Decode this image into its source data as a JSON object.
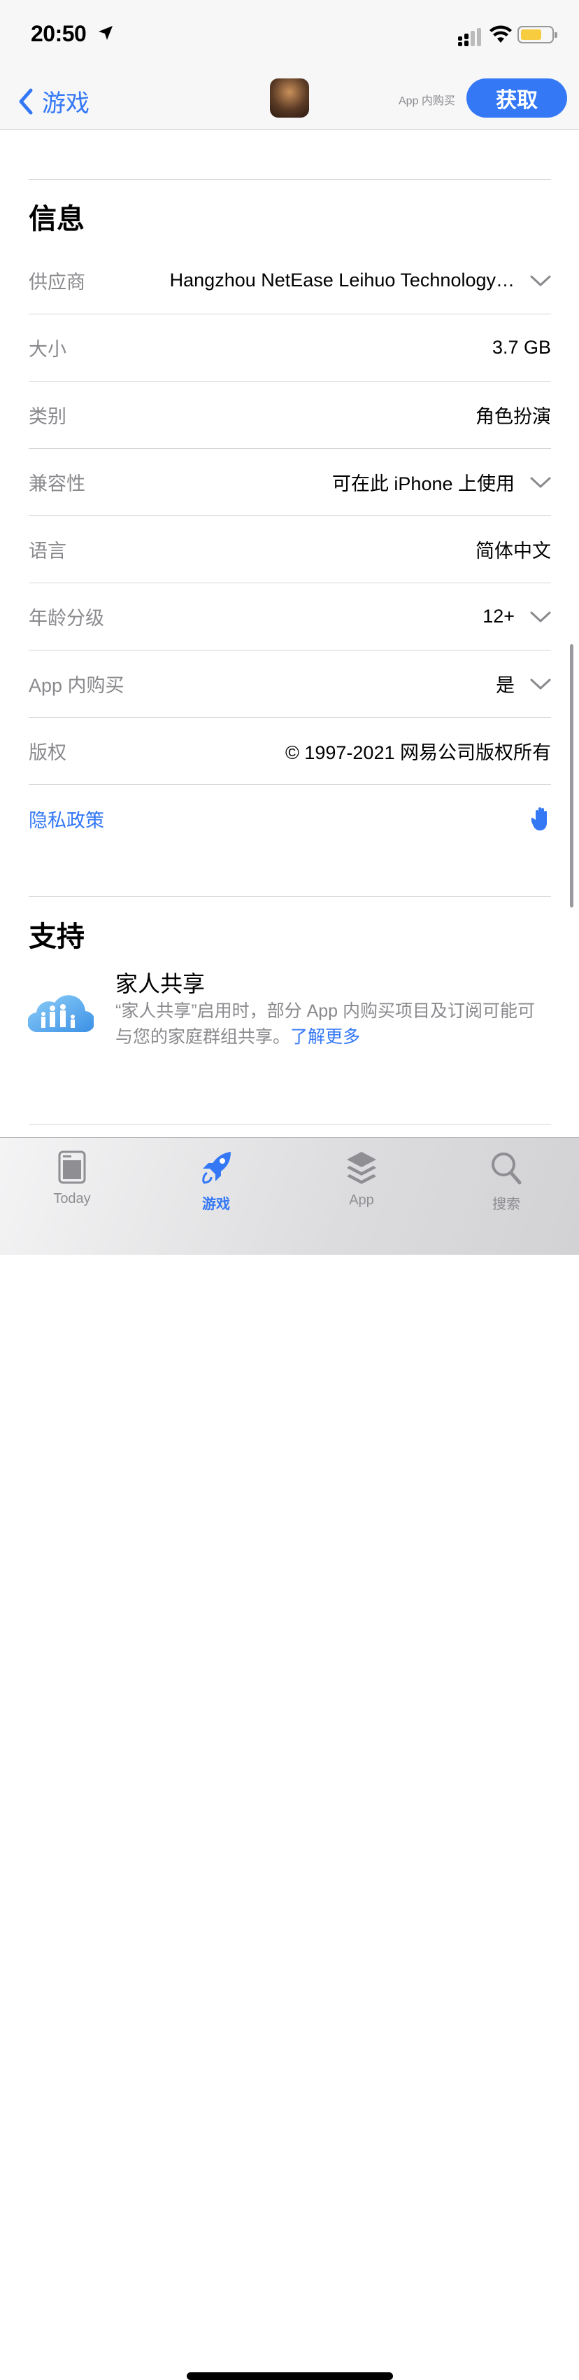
{
  "status": {
    "time": "20:50"
  },
  "nav": {
    "back_label": "游戏",
    "iap_label": "App 内购买",
    "get_label": "获取"
  },
  "info": {
    "heading": "信息",
    "rows": [
      {
        "key": "供应商",
        "value": "Hangzhou NetEase Leihuo Technology…",
        "expandable": true
      },
      {
        "key": "大小",
        "value": "3.7 GB",
        "expandable": false
      },
      {
        "key": "类别",
        "value": "角色扮演",
        "expandable": false
      },
      {
        "key": "兼容性",
        "value": "可在此 iPhone 上使用",
        "expandable": true
      },
      {
        "key": "语言",
        "value": "简体中文",
        "expandable": false
      },
      {
        "key": "年龄分级",
        "value": "12+",
        "expandable": true
      },
      {
        "key": "App 内购买",
        "value": "是",
        "expandable": true
      },
      {
        "key": "版权",
        "value": "© 1997-2021 网易公司版权所有",
        "expandable": false
      }
    ],
    "privacy_label": "隐私政策"
  },
  "support": {
    "heading": "支持",
    "family_title": "家人共享",
    "family_desc": "“家人共享”启用时，部分 App 内购买项目及订阅可能可与您的家庭群组共享。",
    "learn_more": "了解更多"
  },
  "tabs": [
    {
      "label": "Today"
    },
    {
      "label": "游戏",
      "active": true
    },
    {
      "label": "App"
    },
    {
      "label": "搜索"
    }
  ],
  "colors": {
    "accent": "#3478f6",
    "battery": "#f8cc3f"
  }
}
